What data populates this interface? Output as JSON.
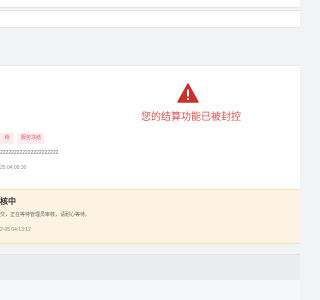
{
  "blocked": {
    "title": "您的结算功能已被封控",
    "icon": "warning-triangle-icon"
  },
  "order": {
    "tags": [
      "待",
      "服务冻结"
    ],
    "code": "222222222222222222222",
    "datetime": "25 04:09:30"
  },
  "notice": {
    "title": "核中",
    "description": "交，正在等待管理员审核，请耐心等待。",
    "datetime": "2-05 04:13:12"
  },
  "colors": {
    "warning": "#d9534f",
    "tag_bg": "#fdecee",
    "notice_bg": "#fcf3e2"
  }
}
